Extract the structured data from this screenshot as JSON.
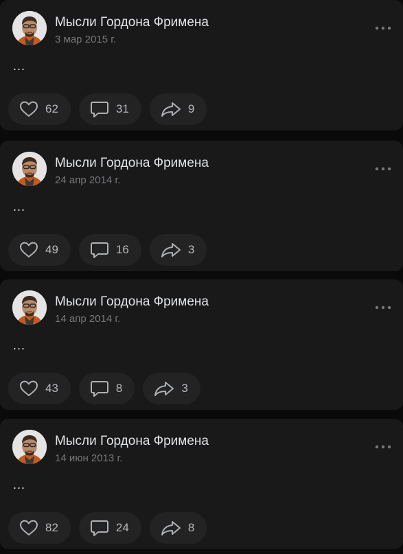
{
  "posts": [
    {
      "author": "Мысли Гордона Фримена",
      "date": "3 мар 2015 г.",
      "text": "...",
      "likes": "62",
      "comments": "31",
      "shares": "9"
    },
    {
      "author": "Мысли Гордона Фримена",
      "date": "24 апр 2014 г.",
      "text": "...",
      "likes": "49",
      "comments": "16",
      "shares": "3"
    },
    {
      "author": "Мысли Гордона Фримена",
      "date": "14 апр 2014 г.",
      "text": "...",
      "likes": "43",
      "comments": "8",
      "shares": "3"
    },
    {
      "author": "Мысли Гордона Фримена",
      "date": "14 июн 2013 г.",
      "text": "...",
      "likes": "82",
      "comments": "24",
      "shares": "8"
    }
  ],
  "icons": {
    "like": "heart-icon",
    "comment": "comment-bubble-icon",
    "share": "share-arrow-icon",
    "more": "more-horizontal-icon"
  },
  "colors": {
    "background": "#0a0a0a",
    "card": "#19191a",
    "action_pill": "#232324",
    "text_primary": "#e1e3e6",
    "text_secondary": "#76787a"
  }
}
